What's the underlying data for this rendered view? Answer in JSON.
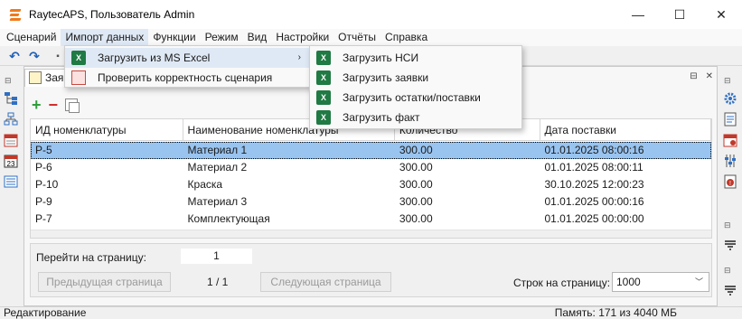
{
  "window": {
    "title": "RaytecAPS, Пользователь Admin",
    "minimize_label": "—",
    "maximize_label": "☐",
    "close_label": "✕"
  },
  "menubar": [
    "Сценарий",
    "Импорт данных",
    "Функции",
    "Режим",
    "Вид",
    "Настройки",
    "Отчёты",
    "Справка"
  ],
  "import_menu": {
    "items": [
      {
        "label": "Загрузить из MS Excel",
        "arrow": "›",
        "icon": "excel-icon"
      },
      {
        "label": "Проверить корректность сценария",
        "icon": "check-scenario-icon"
      }
    ]
  },
  "excel_submenu": {
    "items": [
      {
        "label": "Загрузить НСИ",
        "icon": "excel-icon"
      },
      {
        "label": "Загрузить заявки",
        "icon": "excel-icon"
      },
      {
        "label": "Загрузить остатки/поставки",
        "icon": "excel-icon"
      },
      {
        "label": "Загрузить факт",
        "icon": "excel-icon"
      }
    ]
  },
  "doc_tab": {
    "label": "Заяв"
  },
  "grid": {
    "columns": [
      "ИД номенклатуры",
      "Наименование номенклатуры",
      "Количество",
      "Дата поставки"
    ],
    "rows": [
      [
        "Р-5",
        "Материал 1",
        "300.00",
        "01.01.2025 08:00:16"
      ],
      [
        "Р-6",
        "Материал 2",
        "300.00",
        "01.01.2025 08:00:11"
      ],
      [
        "Р-10",
        "Краска",
        "300.00",
        "30.10.2025 12:00:23"
      ],
      [
        "Р-9",
        "Материал 3",
        "300.00",
        "01.01.2025 00:00:16"
      ],
      [
        "Р-7",
        "Комплектующая",
        "300.00",
        "01.01.2025 00:00:00"
      ]
    ],
    "selected_row": 0
  },
  "paging": {
    "goto_label": "Перейти на страницу:",
    "page_value": "1",
    "prev_label": "Предыдущая страница",
    "page_count": "1 / 1",
    "next_label": "Следующая страница",
    "rows_label": "Строк на страницу:",
    "rows_value": "1000"
  },
  "status": {
    "mode": "Редактирование",
    "memory": "Память: 171 из 4040 МБ"
  },
  "colors": {
    "selection": "#99c4f0",
    "menu_hover": "#dfe9f5",
    "brand": "#f07a1a"
  }
}
